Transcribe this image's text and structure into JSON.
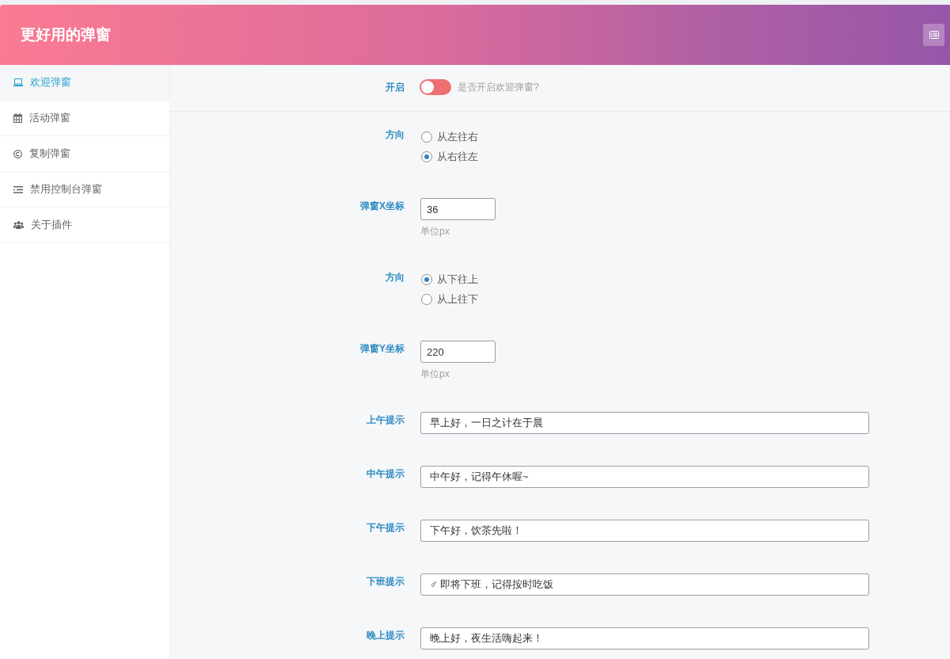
{
  "header": {
    "title": "更好用的弹窗"
  },
  "sidebar": {
    "items": [
      {
        "label": "欢迎弹窗",
        "selected": true
      },
      {
        "label": "活动弹窗",
        "selected": false
      },
      {
        "label": "复制弹窗",
        "selected": false
      },
      {
        "label": "禁用控制台弹窗",
        "selected": false
      },
      {
        "label": "关于插件",
        "selected": false
      }
    ]
  },
  "form": {
    "rows": [
      {
        "kind": "switch",
        "label": "开启",
        "on": false,
        "hint": "是否开启欢迎弹窗?"
      },
      {
        "kind": "radio",
        "label": "方向",
        "options": [
          {
            "label": "从左往右",
            "selected": false
          },
          {
            "label": "从右往左",
            "selected": true
          }
        ]
      },
      {
        "kind": "number",
        "label": "弹窗X坐标",
        "value": "36",
        "hint": "单位px"
      },
      {
        "kind": "radio",
        "label": "方向",
        "options": [
          {
            "label": "从下往上",
            "selected": true
          },
          {
            "label": "从上往下",
            "selected": false
          }
        ]
      },
      {
        "kind": "number",
        "label": "弹窗Y坐标",
        "value": "220",
        "hint": "单位px"
      },
      {
        "kind": "text",
        "label": "上午提示",
        "value": "早上好，一日之计在于晨"
      },
      {
        "kind": "text",
        "label": "中午提示",
        "value": "中午好，记得午休喔~"
      },
      {
        "kind": "text",
        "label": "下午提示",
        "value": "下午好，饮茶先啦！"
      },
      {
        "kind": "text",
        "label": "下班提示",
        "value": "♂ 即将下班，记得按时吃饭"
      },
      {
        "kind": "text",
        "label": "晚上提示",
        "value": "晚上好，夜生活嗨起来！"
      }
    ]
  }
}
